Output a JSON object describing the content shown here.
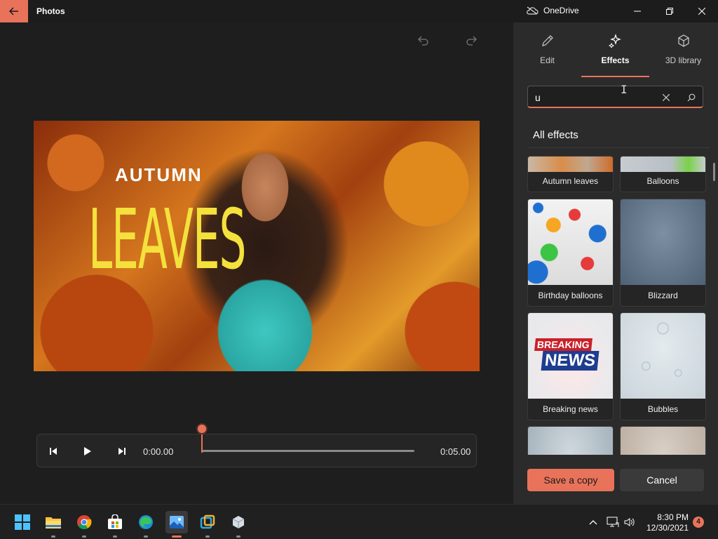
{
  "titlebar": {
    "app_title": "Photos",
    "onedrive_label": "OneDrive",
    "accent": "#e8735a"
  },
  "preview": {
    "title_small": "AUTUMN",
    "title_large": "LEAVES"
  },
  "player": {
    "current_time": "0:00.00",
    "end_time": "0:05.00",
    "progress": 0
  },
  "panel": {
    "tabs": [
      {
        "label": "Edit",
        "icon": "pencil-icon",
        "active": false
      },
      {
        "label": "Effects",
        "icon": "sparkle-icon",
        "active": true
      },
      {
        "label": "3D library",
        "icon": "cube-icon",
        "active": false
      }
    ],
    "search": {
      "value": "u"
    },
    "section_title": "All effects",
    "effects": [
      {
        "name": "Autumn leaves"
      },
      {
        "name": "Balloons"
      },
      {
        "name": "Birthday balloons"
      },
      {
        "name": "Blizzard"
      },
      {
        "name": "Breaking news",
        "thumb_text_1": "BREAKING",
        "thumb_text_2": "NEWS"
      },
      {
        "name": "Bubbles"
      },
      {
        "name": ""
      },
      {
        "name": ""
      }
    ],
    "save_label": "Save a copy",
    "cancel_label": "Cancel"
  },
  "taskbar": {
    "apps": [
      "windows-start",
      "file-explorer",
      "chrome",
      "microsoft-store",
      "edge",
      "photos",
      "app-blue",
      "app-3d"
    ],
    "time": "8:30 PM",
    "date": "12/30/2021",
    "notification_count": "4"
  }
}
